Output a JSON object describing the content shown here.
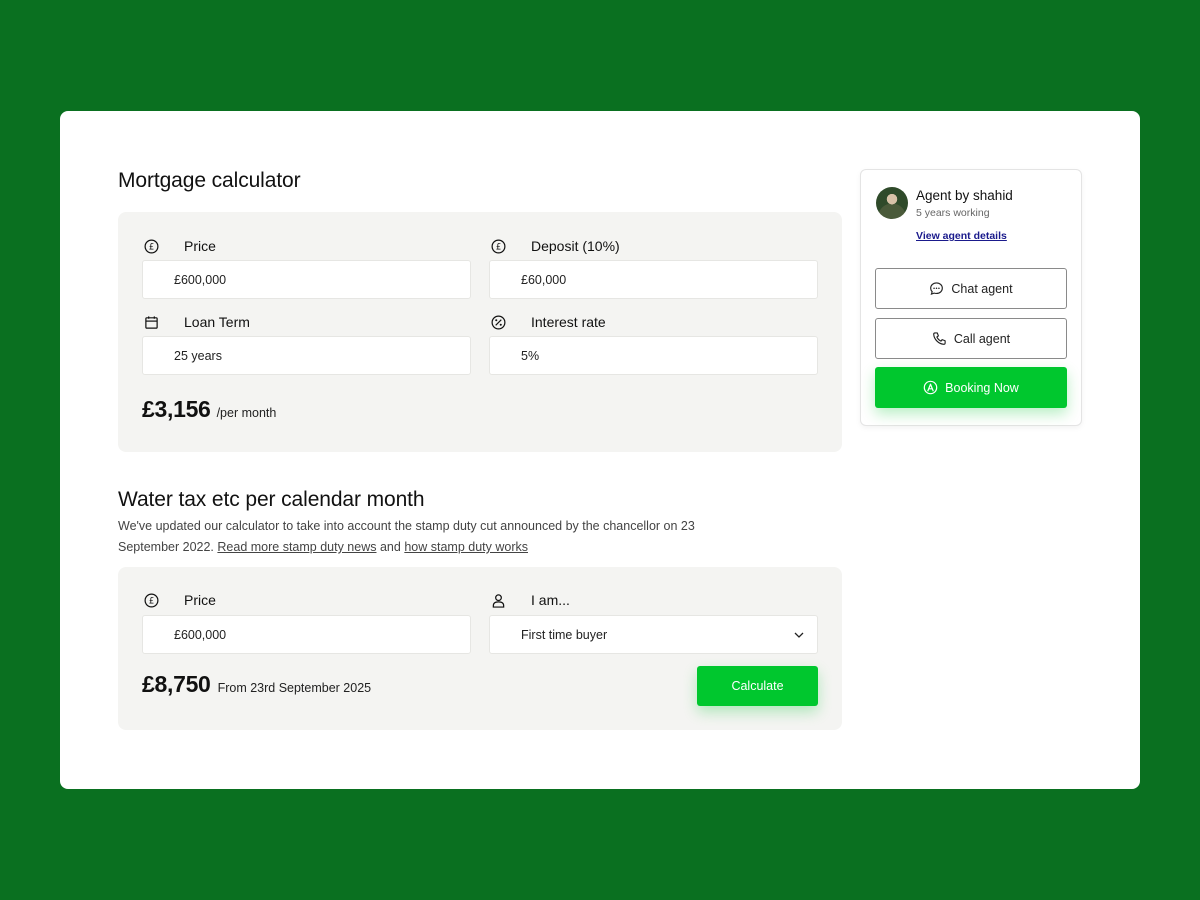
{
  "mortgage": {
    "title": "Mortgage calculator",
    "price_label": "Price",
    "price_value": "£600,000",
    "deposit_label": "Deposit (10%)",
    "deposit_value": "£60,000",
    "loan_term_label": "Loan Term",
    "loan_term_value": "25 years",
    "interest_label": "Interest rate",
    "interest_value": "5%",
    "monthly_amount": "£3,156",
    "monthly_suffix": "/per month"
  },
  "water_tax": {
    "title": "Water tax etc per calendar month",
    "description_prefix": "We've updated our calculator to take into account the stamp duty cut announced by the chancellor on 23 September 2022.",
    "link_news": "Read more stamp duty news",
    "joiner": "and",
    "link_how": "how stamp duty works",
    "price_label": "Price",
    "price_value": "£600,000",
    "iam_label": "I am...",
    "iam_selected": "First time buyer",
    "result_amount": "£8,750",
    "result_note": "From 23rd September 2025",
    "calculate_label": "Calculate"
  },
  "agent": {
    "name": "Agent by shahid",
    "experience": "5 years working",
    "details_link": "View agent details",
    "chat_label": "Chat agent",
    "call_label": "Call agent",
    "booking_label": "Booking Now"
  },
  "colors": {
    "background": "#0a7020",
    "accent": "#00c72e",
    "panel": "#f4f4f2",
    "link": "#1a1a8c"
  }
}
